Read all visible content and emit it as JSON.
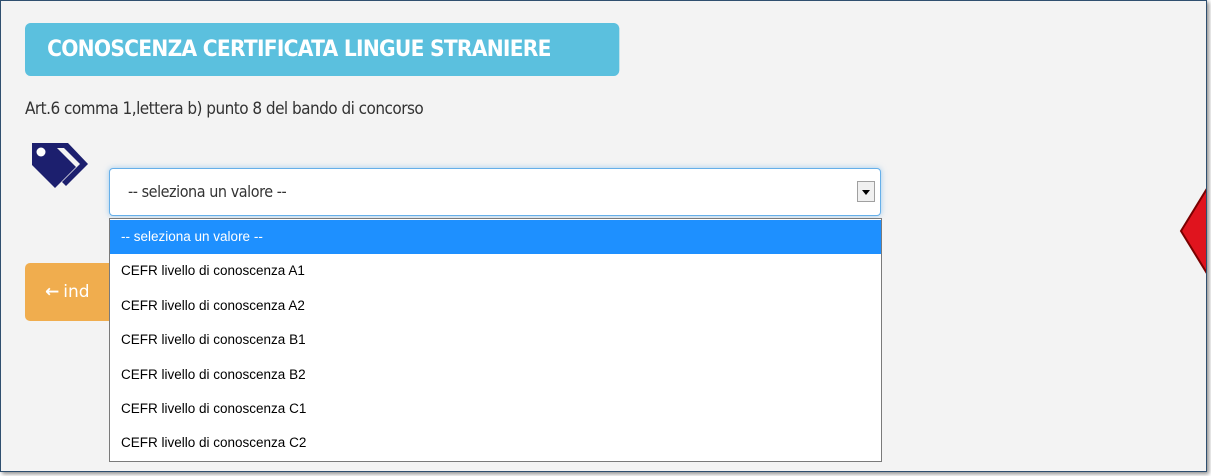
{
  "section": {
    "title": "CONOSCENZA CERTIFICATA LINGUE STRANIERE",
    "subtitle": "Art.6 comma 1,lettera b) punto 8 del bando di concorso",
    "icon": "tags-icon"
  },
  "select": {
    "value": "-- seleziona un valore --",
    "options": [
      "-- seleziona un valore --",
      "CEFR livello di conoscenza A1",
      "CEFR livello di conoscenza A2",
      "CEFR livello di conoscenza B1",
      "CEFR livello di conoscenza B2",
      "CEFR livello di conoscenza C1",
      "CEFR livello di conoscenza C2"
    ],
    "selected_index": 0
  },
  "back_button": {
    "icon": "arrow-left-icon",
    "label": "ind"
  },
  "colors": {
    "header_bg": "#5bc0de",
    "button_warning": "#f0ad4e",
    "option_highlight": "#1e90ff",
    "icon_navy": "#1c1f6e",
    "marker_red": "#e0141e"
  }
}
